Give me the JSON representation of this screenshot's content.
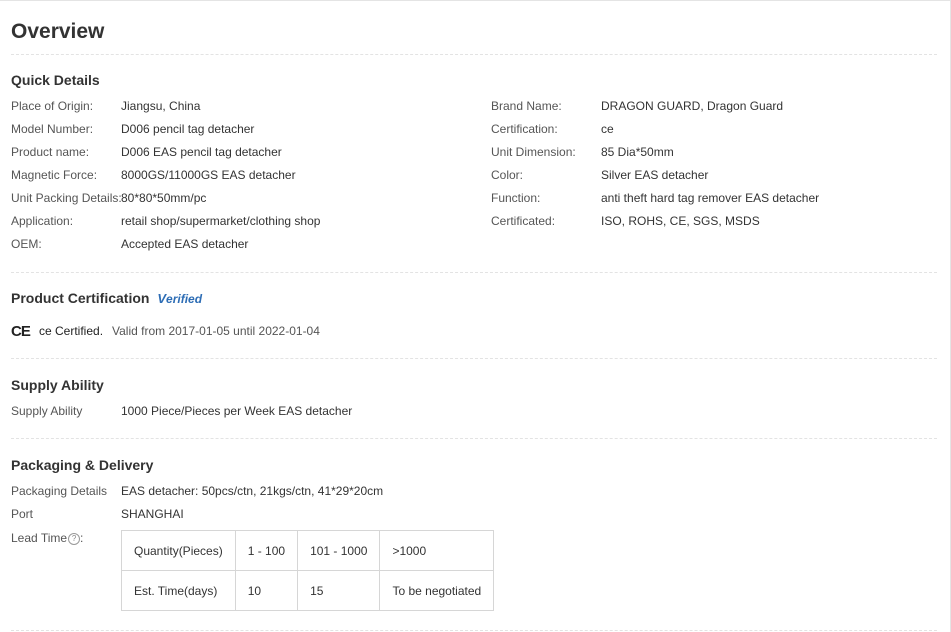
{
  "title": "Overview",
  "quick_details": {
    "heading": "Quick Details",
    "left": [
      {
        "label": "Place of Origin:",
        "value": "Jiangsu, China"
      },
      {
        "label": "Model Number:",
        "value": "D006 pencil tag detacher"
      },
      {
        "label": "Product name:",
        "value": "D006 EAS pencil tag detacher"
      },
      {
        "label": "Magnetic Force:",
        "value": "8000GS/11000GS EAS detacher"
      },
      {
        "label": "Unit Packing Details:",
        "value": "80*80*50mm/pc"
      },
      {
        "label": "Application:",
        "value": "retail shop/supermarket/clothing shop"
      },
      {
        "label": "OEM:",
        "value": "Accepted EAS detacher"
      }
    ],
    "right": [
      {
        "label": "Brand Name:",
        "value": "DRAGON GUARD, Dragon Guard"
      },
      {
        "label": "Certification:",
        "value": "ce"
      },
      {
        "label": "Unit Dimension:",
        "value": "85 Dia*50mm"
      },
      {
        "label": "Color:",
        "value": "Silver EAS detacher"
      },
      {
        "label": "Function:",
        "value": "anti theft hard tag remover EAS detacher"
      },
      {
        "label": "Certificated:",
        "value": "ISO, ROHS, CE, SGS, MSDS"
      }
    ]
  },
  "product_certification": {
    "heading": "Product Certification",
    "verified_v": "V",
    "verified_rest": "erified",
    "ce_icon": "CE",
    "cert_name": "ce Certified.",
    "valid_text": "Valid from 2017-01-05 until 2022-01-04"
  },
  "supply_ability": {
    "heading": "Supply Ability",
    "label": "Supply Ability",
    "value": "1000 Piece/Pieces per Week EAS detacher"
  },
  "packaging_delivery": {
    "heading": "Packaging & Delivery",
    "packaging_label": "Packaging Details",
    "packaging_value": "EAS detacher: 50pcs/ctn, 21kgs/ctn, 41*29*20cm",
    "port_label": "Port",
    "port_value": "SHANGHAI",
    "lead_label": "Lead Time",
    "help_icon": "?",
    "lead_table": {
      "row1": [
        "Quantity(Pieces)",
        "1 - 100",
        "101 - 1000",
        ">1000"
      ],
      "row2": [
        "Est. Time(days)",
        "10",
        "15",
        "To be negotiated"
      ]
    }
  }
}
